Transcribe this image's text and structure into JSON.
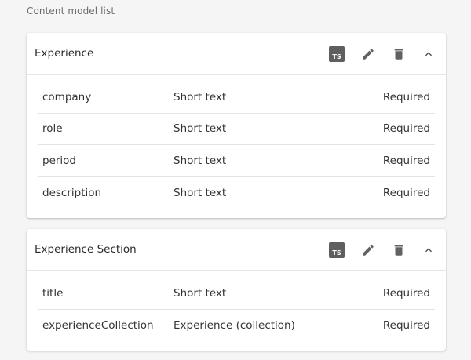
{
  "section_title": "Content model list",
  "icons": {
    "ts": "typescript-icon",
    "edit": "pencil-icon",
    "delete": "trash-icon",
    "collapse": "chevron-up-icon"
  },
  "ts_label": "TS",
  "models": [
    {
      "name": "Experience",
      "fields": [
        {
          "name": "company",
          "type": "Short text",
          "required": "Required"
        },
        {
          "name": "role",
          "type": "Short text",
          "required": "Required"
        },
        {
          "name": "period",
          "type": "Short text",
          "required": "Required"
        },
        {
          "name": "description",
          "type": "Short text",
          "required": "Required"
        }
      ]
    },
    {
      "name": "Experience Section",
      "fields": [
        {
          "name": "title",
          "type": "Short text",
          "required": "Required"
        },
        {
          "name": "experienceCollection",
          "type": "Experience (collection)",
          "required": "Required"
        }
      ]
    }
  ]
}
